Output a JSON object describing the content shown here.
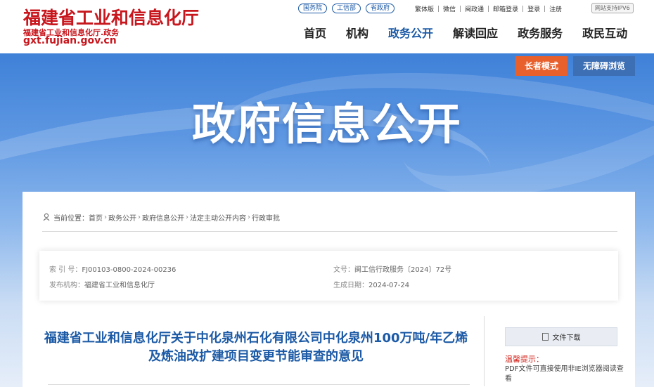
{
  "header": {
    "logo_title": "福建省工业和信息化厅",
    "logo_subtitle": "福建省工业和信息化厅.政务",
    "logo_domain": "gxt.fujian.gov.cn",
    "top_pills": [
      "国务院",
      "工信部",
      "省政府"
    ],
    "util_links": [
      "繁体版",
      "微信",
      "闽政通",
      "邮箱登录",
      "登录",
      "注册"
    ],
    "ipv6_label": "网站支持IPV6",
    "nav": [
      "首页",
      "机构",
      "政务公开",
      "解读回应",
      "政务服务",
      "政民互动"
    ],
    "nav_active_index": 2
  },
  "banner": {
    "title": "政府信息公开",
    "elder_mode": "长者模式",
    "accessible": "无障碍浏览"
  },
  "breadcrumb": {
    "label": "当前位置：",
    "items": [
      "首页",
      "政务公开",
      "政府信息公开",
      "法定主动公开内容",
      "行政审批"
    ],
    "separator": "›"
  },
  "meta": {
    "index_label": "索 引 号：",
    "index_value": "FJ00103-0800-2024-00236",
    "doc_label": "文号：",
    "doc_value": "闽工信行政服务〔2024〕72号",
    "org_label": "发布机构：",
    "org_value": "福建省工业和信息化厅",
    "date_label": "生成日期：",
    "date_value": "2024-07-24"
  },
  "article": {
    "title": "福建省工业和信息化厅关于中化泉州石化有限公司中化泉州100万吨/年乙烯及炼油改扩建项目变更节能审查的意见"
  },
  "sidebar": {
    "download_label": "文件下载",
    "tip_heading": "温馨提示：",
    "tip_text": "PDF文件可直接使用非IE浏览器阅读查看"
  },
  "colors": {
    "brand_red": "#c8161d",
    "link_blue": "#1c5aa6",
    "elder_orange": "#e8602c",
    "access_blue": "#3d6fb5"
  }
}
